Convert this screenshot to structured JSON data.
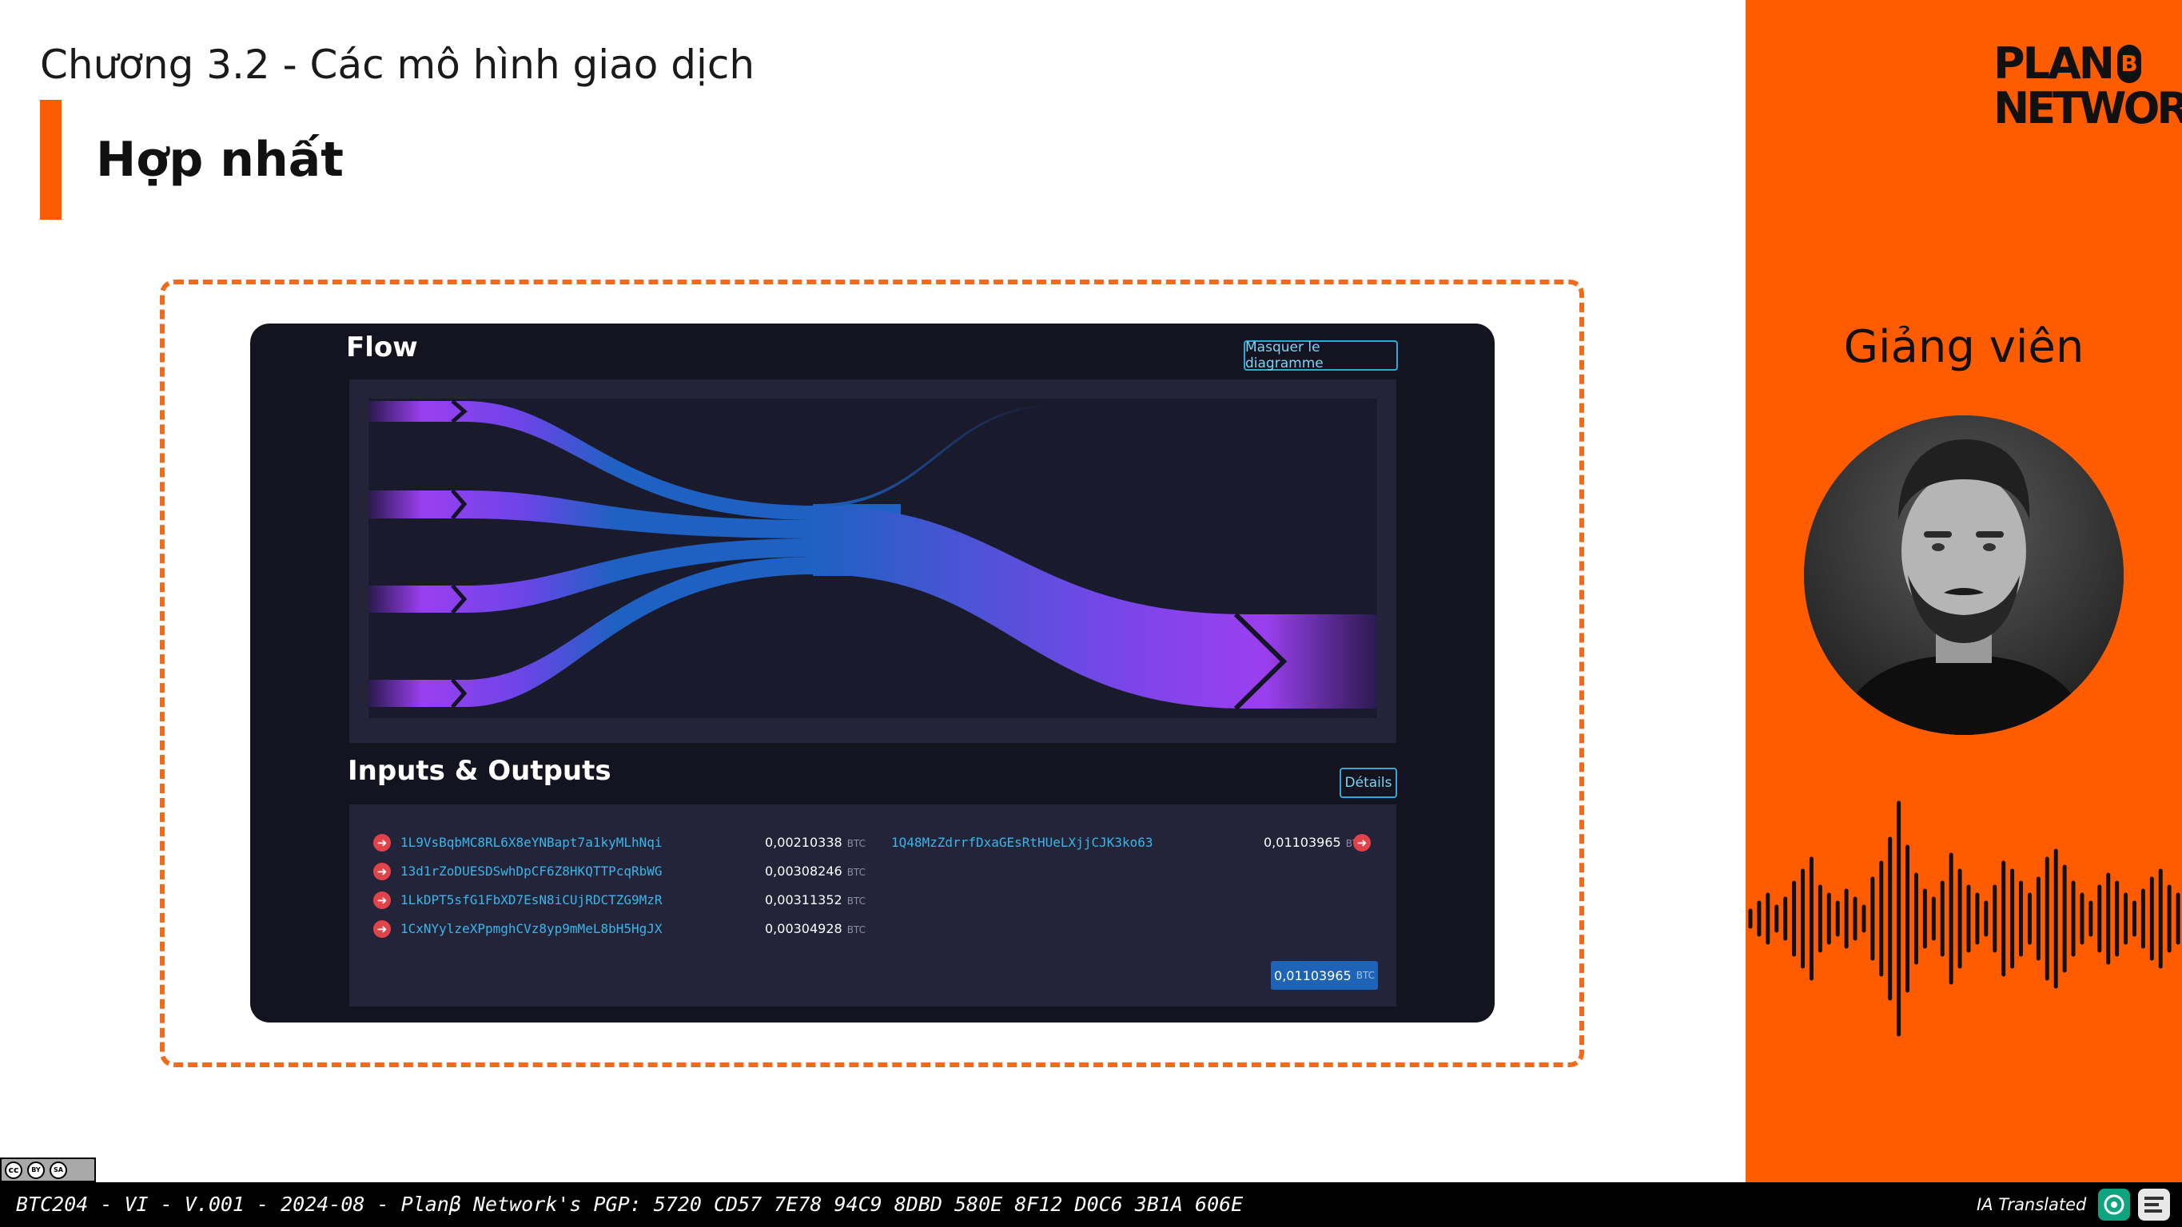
{
  "slide": {
    "chapter": "Chương 3.2 - Các mô hình giao dịch",
    "section_title": "Hợp nhất"
  },
  "explorer": {
    "flow_heading": "Flow",
    "hide_diagram_button": "Masquer le diagramme",
    "io_heading": "Inputs & Outputs",
    "details_button": "Détails",
    "unit": "BTC",
    "inputs": [
      {
        "address": "1L9VsBqbMC8RL6X8eYNBapt7a1kyMLhNqi",
        "amount": "0,00210338"
      },
      {
        "address": "13d1rZoDUESDSwhDpCF6Z8HKQTTPcqRbWG",
        "amount": "0,00308246"
      },
      {
        "address": "1LkDPT5sfG1FbXD7EsN8iCUjRDCTZG9MzR",
        "amount": "0,00311352"
      },
      {
        "address": "1CxNYylzeXPpmghCVz8yp9mMeL8bH5HgJX",
        "amount": "0,00304928"
      }
    ],
    "outputs": [
      {
        "address": "1Q48MzZdrrfDxaGEsRtHUeLXjjCJK3ko63",
        "amount": "0,01103965"
      }
    ],
    "total": "0,01103965"
  },
  "sidebar": {
    "logo_line1": "PLAN",
    "logo_b": "B",
    "logo_line2": "NETWORK",
    "lecturer_label": "Giảng viên",
    "accent_color": "#ff5c00"
  },
  "footer": {
    "text": "BTC204 - VI - V.001 - 2024-08 - Planβ Network's PGP: 5720 CD57 7E78 94C9 8DBD 580E 8F12 D0C6 3B1A 606E",
    "ia_translated": "IA Translated",
    "license_by": "BY",
    "license_sa": "SA"
  }
}
